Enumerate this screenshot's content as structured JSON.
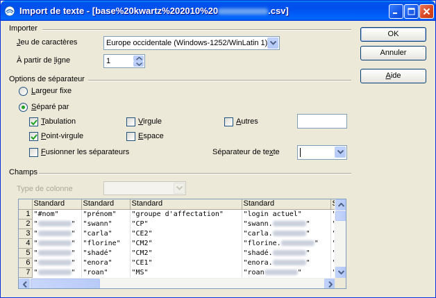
{
  "window": {
    "title": "Import de texte - [base%20kwartz%202010%20",
    "title_suffix": ".csv]"
  },
  "importer": {
    "group_label": "Importer",
    "charset_label": "Jeu de caractères",
    "charset_value": "Europe occidentale (Windows-1252/WinLatin 1)",
    "from_line_label": "À partir de la ligne",
    "from_line_value": "1"
  },
  "separator_options": {
    "group_label": "Options de séparateur",
    "fixed_width_label": "Largeur fixe",
    "fixed_width_selected": false,
    "separated_by_label": "Séparé par",
    "separated_by_selected": true,
    "tab_label": "Tabulation",
    "tab_checked": true,
    "comma_label": "Virgule",
    "comma_checked": false,
    "other_label": "Autres",
    "other_checked": false,
    "other_value": "",
    "semicolon_label": "Point-virgule",
    "semicolon_checked": true,
    "space_label": "Espace",
    "space_checked": false,
    "merge_label": "Fusionner les séparateurs",
    "merge_checked": false,
    "text_separator_label": "Séparateur de texte",
    "text_separator_value": ""
  },
  "fields": {
    "group_label": "Champs",
    "column_type_label": "Type de colonne",
    "column_type_value": "",
    "headers": [
      "Standard",
      "Standard",
      "Standard",
      "Standard",
      "S"
    ],
    "rows": [
      {
        "num": "1",
        "cells": [
          "\"#nom\"",
          "\"prénom\"",
          "\"groupe d'affectation\"",
          "\"login actuel\"",
          "\""
        ]
      },
      {
        "num": "2",
        "cells": [
          "\"",
          "\"swann\"",
          "\"CP\"",
          "\"swann.",
          "\""
        ]
      },
      {
        "num": "3",
        "cells": [
          "\"",
          "\"carla\"",
          "\"CE2\"",
          "\"carla.",
          "\""
        ]
      },
      {
        "num": "4",
        "cells": [
          "\"",
          "\"florine\"",
          "\"CM2\"",
          "\"florine.",
          "\""
        ]
      },
      {
        "num": "5",
        "cells": [
          "\"",
          "\"shadé\"",
          "\"CM2\"",
          "\"shadé.",
          "\""
        ]
      },
      {
        "num": "6",
        "cells": [
          "\"",
          "\"enora\"",
          "\"CE1\"",
          "\"enora.",
          "\""
        ]
      },
      {
        "num": "7",
        "cells": [
          "\"",
          "\"roan\"",
          "\"MS\"",
          "\"roan",
          "\""
        ]
      }
    ]
  },
  "buttons": {
    "ok": "OK",
    "cancel": "Annuler",
    "help": "Aide"
  }
}
